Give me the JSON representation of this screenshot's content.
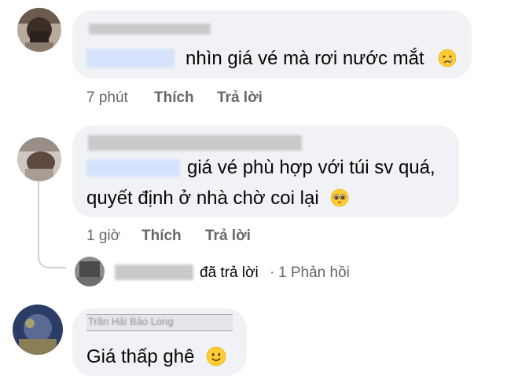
{
  "comments": [
    {
      "text": "nhìn giá vé mà rơi nước mắt",
      "emoji_icon": "crying-face-icon",
      "time": "7 phút",
      "like_label": "Thích",
      "reply_label": "Trả lời"
    },
    {
      "text_line1": "giá vé phù hợp với túi sv quá,",
      "text_line2": "quyết định ở nhà chờ coi lại",
      "emoji_icon": "pleading-face-icon",
      "time": "1 giờ",
      "like_label": "Thích",
      "reply_label": "Trả lời",
      "reply_summary": {
        "replied_label": "đã trả lời",
        "separator": "·",
        "count_label": "1 Phản hồi"
      }
    },
    {
      "author": "Trần Hải Bảo Long",
      "text": "Giá thấp ghê",
      "emoji_icon": "slightly-smiling-face-icon"
    }
  ],
  "colors": {
    "bubble": "#f0f2f5",
    "meta_text": "#65676b",
    "tag_blue": "#d4e3fb",
    "thread_line": "#ced0d4"
  }
}
